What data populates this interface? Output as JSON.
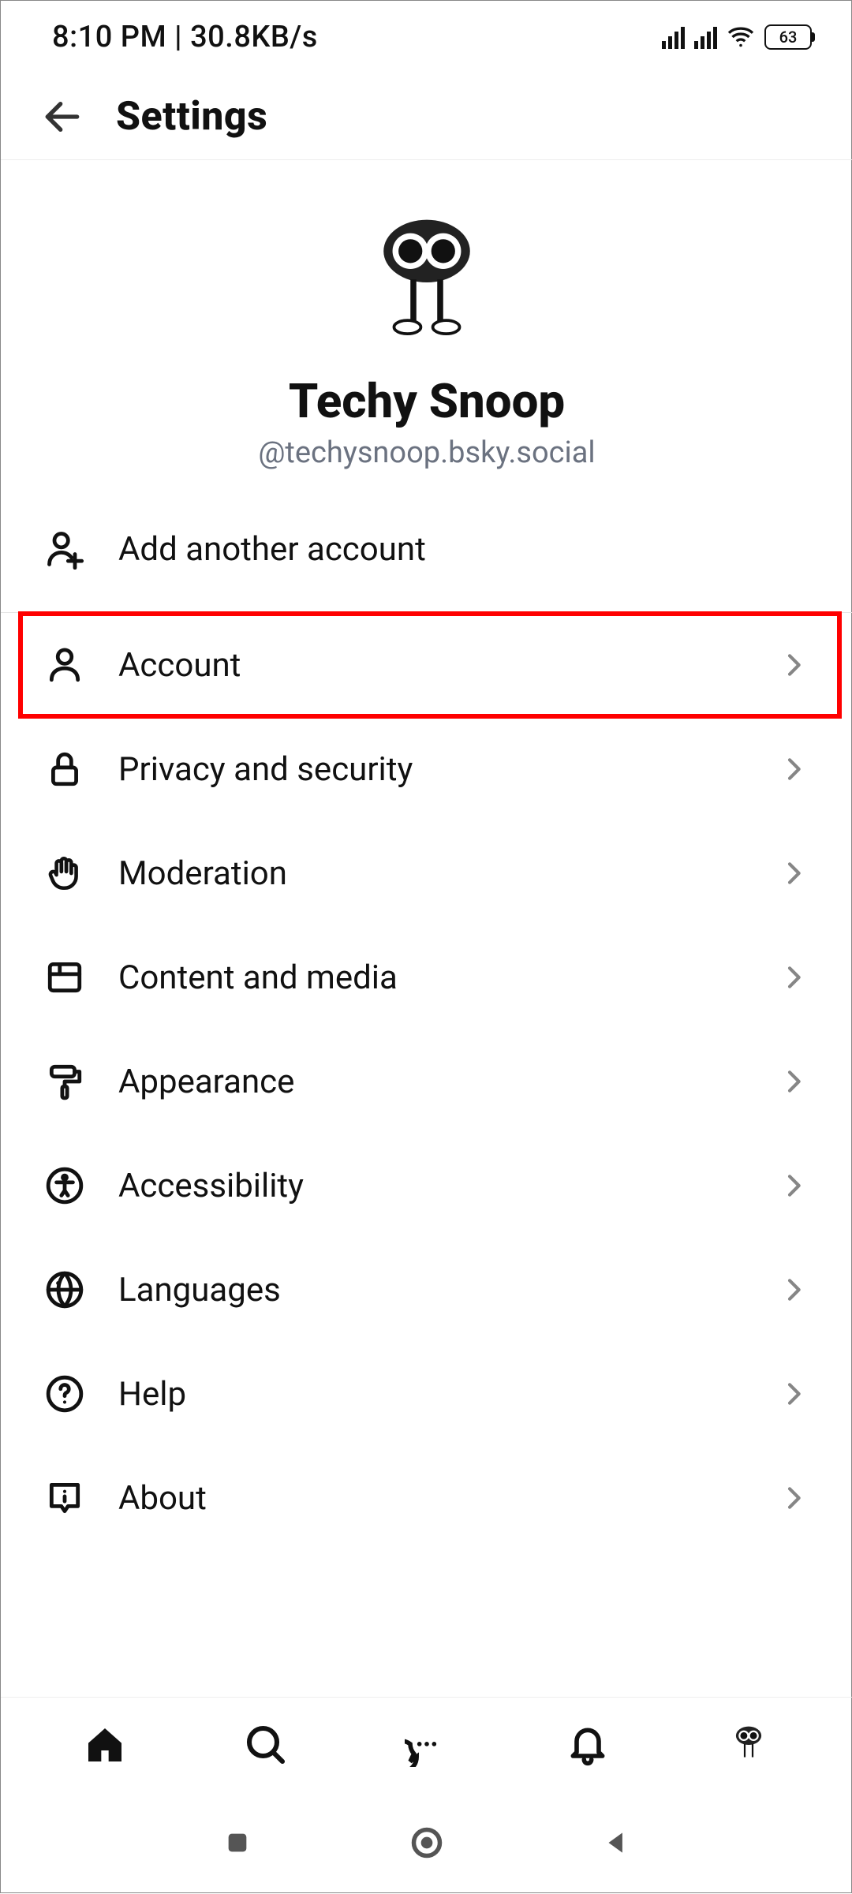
{
  "statusbar": {
    "time_net": "8:10 PM | 30.8KB/s",
    "battery": "63"
  },
  "header": {
    "title": "Settings"
  },
  "profile": {
    "display_name": "Techy Snoop",
    "handle": "@techysnoop.bsky.social"
  },
  "add_account": {
    "label": "Add another account"
  },
  "items": [
    {
      "label": "Account",
      "icon": "user",
      "highlighted": true
    },
    {
      "label": "Privacy and security",
      "icon": "lock",
      "highlighted": false
    },
    {
      "label": "Moderation",
      "icon": "hand",
      "highlighted": false
    },
    {
      "label": "Content and media",
      "icon": "panel",
      "highlighted": false
    },
    {
      "label": "Appearance",
      "icon": "brush",
      "highlighted": false
    },
    {
      "label": "Accessibility",
      "icon": "a11y",
      "highlighted": false
    },
    {
      "label": "Languages",
      "icon": "globe",
      "highlighted": false
    },
    {
      "label": "Help",
      "icon": "help",
      "highlighted": false
    },
    {
      "label": "About",
      "icon": "info",
      "highlighted": false
    }
  ],
  "nav": {
    "home": "home",
    "search": "search",
    "chat": "chat",
    "notifications": "notifications",
    "profile": "profile"
  }
}
